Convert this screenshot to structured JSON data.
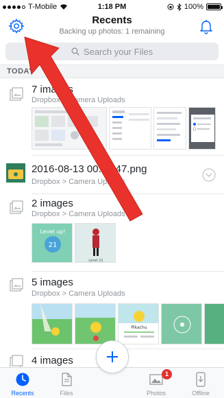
{
  "status_bar": {
    "carrier": "T-Mobile",
    "time": "1:18 PM",
    "battery": "100%",
    "battery_level": 1.0,
    "icons": [
      "signal-dots-icon",
      "wifi-icon",
      "lock-rotation-icon",
      "bluetooth-icon",
      "battery-icon"
    ]
  },
  "header": {
    "title": "Recents",
    "subtitle": "Backing up photos: 1 remaining",
    "left_icon": "gear-icon",
    "right_icon": "bell-icon"
  },
  "search": {
    "placeholder": "Search your Files",
    "icon": "search-icon"
  },
  "section": {
    "label": "TODAY"
  },
  "items": [
    {
      "title": "7 images",
      "path": "Dropbox > Camera Uploads",
      "icon": "images-stack-icon",
      "thumb_count": 4
    },
    {
      "title": "2016-08-13 00.16.47.png",
      "path": "Dropbox > Camera Uploads",
      "icon": "png-file-icon",
      "action_icon": "chevron-down-circle-icon"
    },
    {
      "title": "2 images",
      "path": "Dropbox > Camera Uploads",
      "icon": "images-stack-icon",
      "thumb_count": 2,
      "thumb_text": [
        "Level up!",
        "21",
        "Level 21"
      ]
    },
    {
      "title": "5 images",
      "path": "Dropbox > Camera Uploads",
      "icon": "images-stack-icon",
      "thumb_count": 5,
      "thumb_text": [
        "Pikachu"
      ]
    },
    {
      "title": "4 images",
      "icon": "images-stack-icon"
    }
  ],
  "tab_bar": {
    "tabs": [
      {
        "label": "Recents",
        "icon": "clock-icon",
        "active": true
      },
      {
        "label": "Files",
        "icon": "file-icon",
        "active": false
      },
      {
        "label": "Photos",
        "icon": "photo-icon",
        "active": false,
        "badge": "1"
      },
      {
        "label": "Offline",
        "icon": "offline-phone-icon",
        "active": false
      }
    ],
    "fab_icon": "plus-icon"
  },
  "colors": {
    "accent": "#0061fe",
    "annotation_arrow": "#e8322b",
    "badge": "#e0302f",
    "section_bg": "#f2f3f5"
  }
}
